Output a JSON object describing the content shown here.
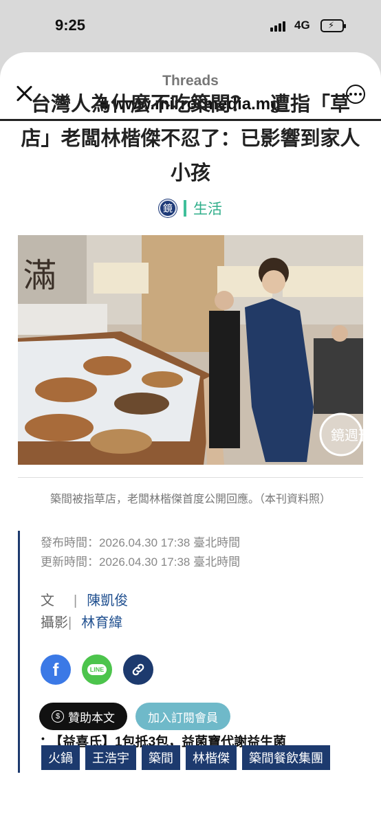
{
  "status": {
    "time": "9:25",
    "network": "4G"
  },
  "browser": {
    "title": "Threads",
    "url": "www.mirrormedia.mg"
  },
  "article": {
    "headline": "台灣人為什麼不吃築間？　遭指「草店」老闆林楷傑不忍了：已影響到家人小孩",
    "category_logo": "鏡",
    "category": "生活",
    "caption": "築間被指草店，老闆林楷傑首度公開回應。（本刊資料照）",
    "published": "發布時間：2026.04.30 17:38 臺北時間",
    "updated": "更新時間：2026.04.30 17:38 臺北時間",
    "credits": [
      {
        "role": "文",
        "name": "陳凱俊"
      },
      {
        "role": "攝影",
        "name": "林育緯"
      }
    ],
    "share": {
      "facebook": "f",
      "line": "LINE"
    },
    "sponsor_label": "贊助本文",
    "subscribe_label": "加入訂閱會員",
    "promo": "【益喜氏】1包抵3包，益菌寶代謝益生菌",
    "tags": [
      "火鍋",
      "王浩宇",
      "築間",
      "林楷傑",
      "築間餐飲集團"
    ],
    "photo_watermark": "鏡週刊"
  }
}
